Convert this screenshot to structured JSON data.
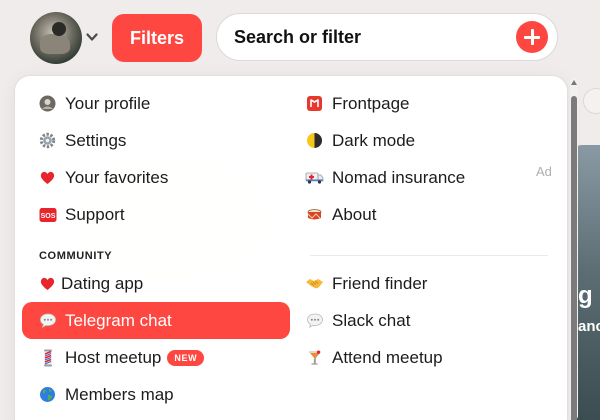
{
  "header": {
    "filters_label": "Filters",
    "search_placeholder": "Search or filter"
  },
  "menu": {
    "left_items": [
      {
        "label": "Your profile",
        "icon": "avatar-icon"
      },
      {
        "label": "Settings",
        "icon": "gear-icon"
      },
      {
        "label": "Your favorites",
        "icon": "heart-icon"
      },
      {
        "label": "Support",
        "icon": "sos-icon"
      }
    ],
    "right_items": [
      {
        "label": "Frontpage",
        "icon": "map-icon"
      },
      {
        "label": "Dark mode",
        "icon": "half-moon-icon"
      },
      {
        "label": "Nomad insurance",
        "icon": "ambulance-icon"
      },
      {
        "label": "About",
        "icon": "drum-icon"
      }
    ],
    "ad_label": "Ad",
    "section_title": "COMMUNITY",
    "community_left": [
      {
        "label": "Dating app",
        "icon": "heart-icon"
      },
      {
        "label": "Telegram chat",
        "icon": "speech-bubble-icon",
        "active": true
      },
      {
        "label": "Host meetup",
        "icon": "barber-pole-icon",
        "badge": "NEW"
      },
      {
        "label": "Members map",
        "icon": "globe-icon"
      }
    ],
    "community_right": [
      {
        "label": "Friend finder",
        "icon": "handshake-icon"
      },
      {
        "label": "Slack chat",
        "icon": "speech-bubble-icon"
      },
      {
        "label": "Attend meetup",
        "icon": "cocktail-icon"
      }
    ]
  },
  "colors": {
    "accent": "#ff4742",
    "background": "#efeceb"
  }
}
